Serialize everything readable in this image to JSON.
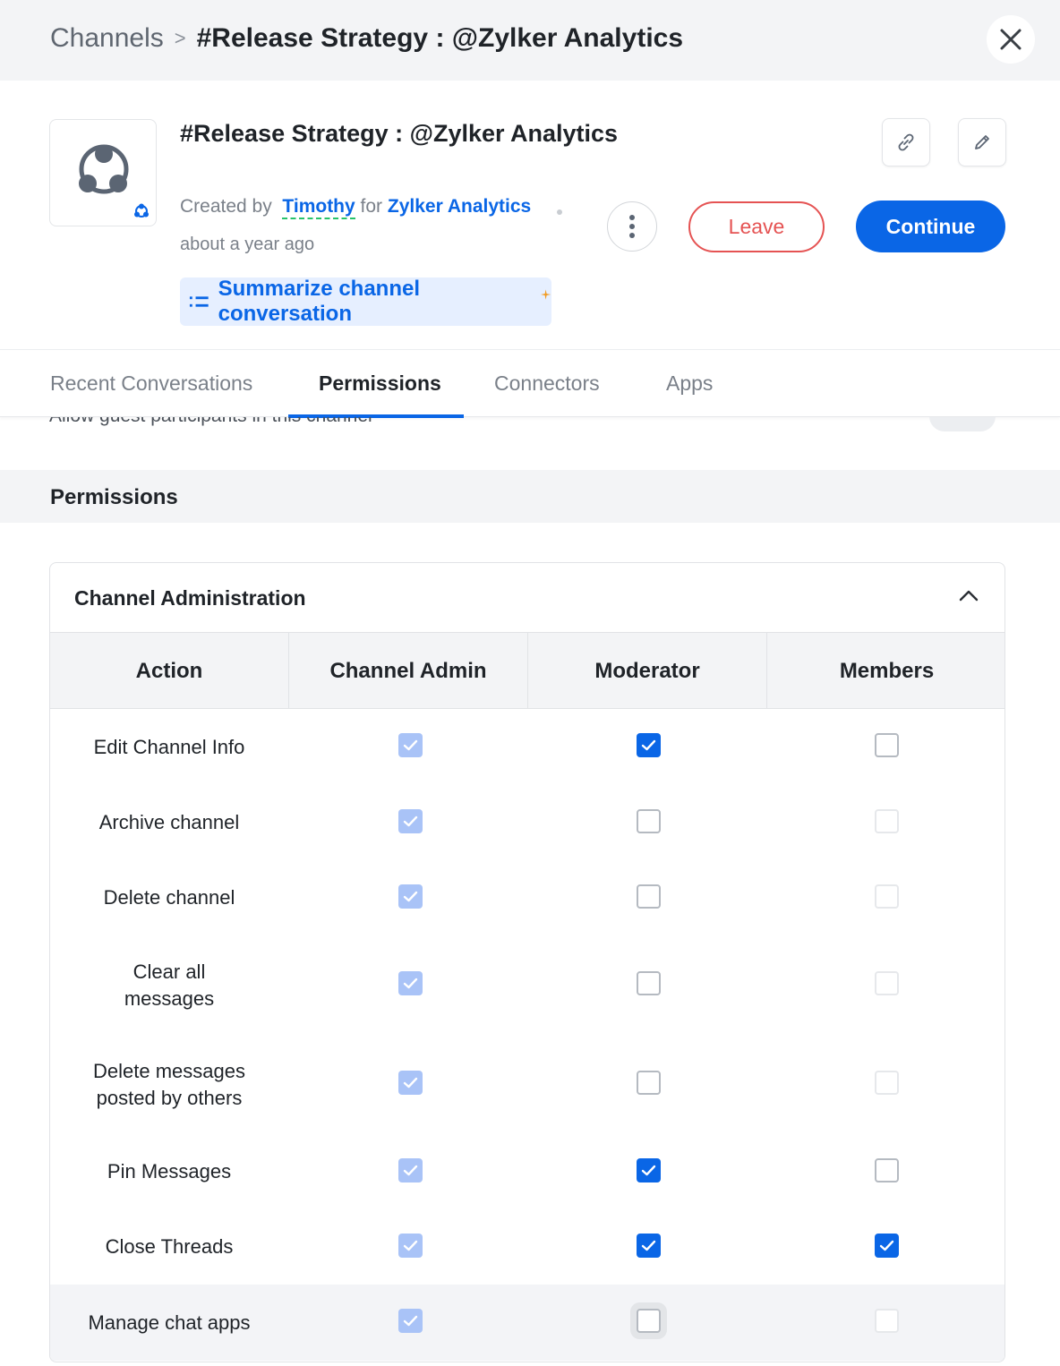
{
  "header": {
    "breadcrumb_root": "Channels",
    "breadcrumb_sep": ">",
    "breadcrumb_current": "#Release Strategy : @Zylker Analytics"
  },
  "channel": {
    "title": "#Release Strategy : @Zylker Analytics",
    "created_by_label": "Created by",
    "creator": "Timothy",
    "for_label": "for",
    "org": "Zylker Analytics",
    "created_ago": "about a year ago",
    "summarize_label": "Summarize channel conversation",
    "leave_label": "Leave",
    "continue_label": "Continue"
  },
  "icons": {
    "close": "close-icon",
    "link": "link-icon",
    "edit": "pencil-icon",
    "more": "more-vertical-icon",
    "summarize": "list-icon",
    "sparkle": "sparkle-icon",
    "collapse": "chevron-up-icon"
  },
  "tabs": [
    {
      "label": "Recent Conversations",
      "active": false
    },
    {
      "label": "Permissions",
      "active": true
    },
    {
      "label": "Connectors",
      "active": false
    },
    {
      "label": "Apps",
      "active": false
    }
  ],
  "cutoff_setting": {
    "label": "Allow guest participants in this channel"
  },
  "permissions": {
    "section_title": "Permissions",
    "group_title": "Channel Administration",
    "columns": [
      "Action",
      "Channel Admin",
      "Moderator",
      "Members"
    ],
    "rows": [
      {
        "action": "Edit Channel Info",
        "admin": "checked-disabled",
        "moderator": "checked",
        "members": "unchecked"
      },
      {
        "action": "Archive channel",
        "admin": "checked-disabled",
        "moderator": "unchecked",
        "members": "unchecked-disabled"
      },
      {
        "action": "Delete channel",
        "admin": "checked-disabled",
        "moderator": "unchecked",
        "members": "unchecked-disabled"
      },
      {
        "action": "Clear all messages",
        "admin": "checked-disabled",
        "moderator": "unchecked",
        "members": "unchecked-disabled"
      },
      {
        "action": "Delete messages posted by others",
        "admin": "checked-disabled",
        "moderator": "unchecked",
        "members": "unchecked-disabled"
      },
      {
        "action": "Pin Messages",
        "admin": "checked-disabled",
        "moderator": "checked",
        "members": "unchecked"
      },
      {
        "action": "Close Threads",
        "admin": "checked-disabled",
        "moderator": "checked",
        "members": "checked"
      },
      {
        "action": "Manage chat apps",
        "admin": "checked-disabled",
        "moderator": "unchecked",
        "members": "unchecked-disabled",
        "highlighted": true
      }
    ]
  },
  "colors": {
    "accent": "#0a66e6",
    "danger": "#e55353",
    "disabled_check": "#a9c3f7",
    "header_bg": "#f3f4f6"
  }
}
